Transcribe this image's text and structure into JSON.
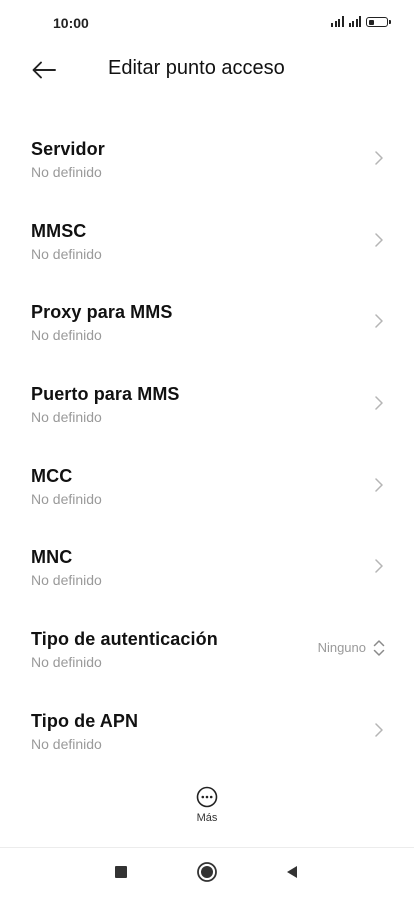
{
  "status_bar": {
    "time": "10:00"
  },
  "header": {
    "title": "Editar punto acceso",
    "back_icon": "arrow-left-icon"
  },
  "items": [
    {
      "label": "Servidor",
      "sub": "No definido",
      "control": "chevron"
    },
    {
      "label": "MMSC",
      "sub": "No definido",
      "control": "chevron"
    },
    {
      "label": "Proxy para MMS",
      "sub": "No definido",
      "control": "chevron"
    },
    {
      "label": "Puerto para MMS",
      "sub": "No definido",
      "control": "chevron"
    },
    {
      "label": "MCC",
      "sub": "No definido",
      "control": "chevron"
    },
    {
      "label": "MNC",
      "sub": "No definido",
      "control": "chevron"
    },
    {
      "label": "Tipo de autenticación",
      "sub": "No definido",
      "value": "Ninguno",
      "control": "updown"
    },
    {
      "label": "Tipo de APN",
      "sub": "No definido",
      "control": "chevron"
    }
  ],
  "more": {
    "label": "Más",
    "icon": "more-horizontal-circle-icon"
  },
  "nav": {
    "recents_icon": "square-icon",
    "home_icon": "circle-icon",
    "back_icon": "triangle-back-icon"
  },
  "colors": {
    "text_primary": "#111111",
    "text_secondary": "#9a9a9a",
    "chevron": "#b5b5b5"
  }
}
